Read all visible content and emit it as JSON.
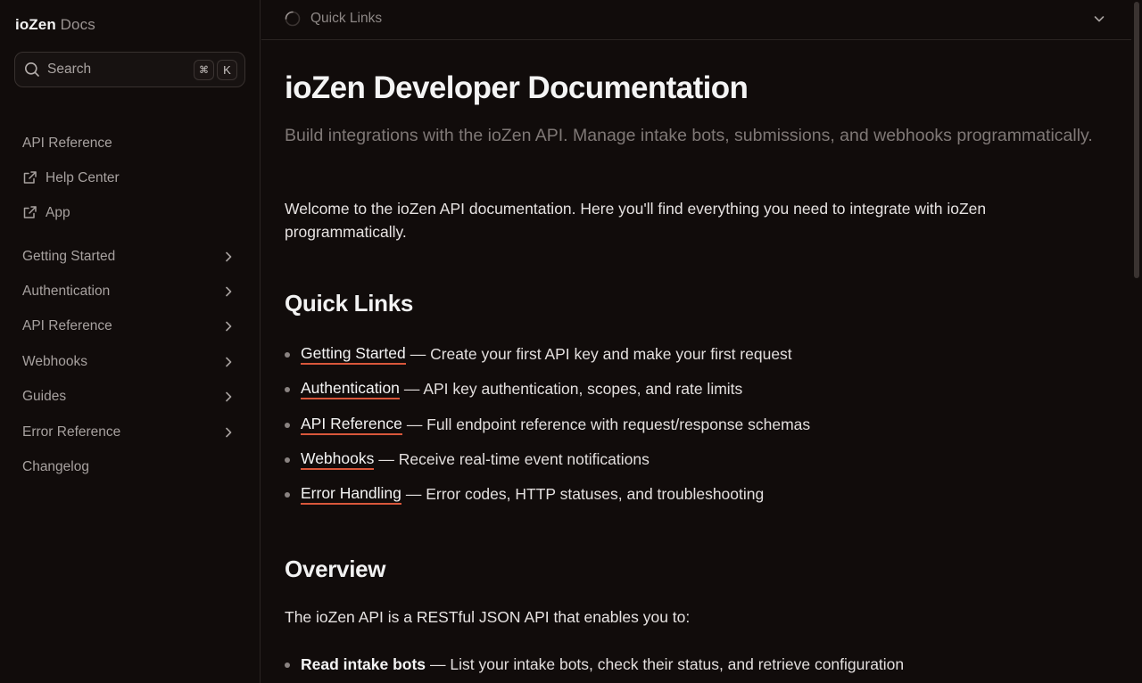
{
  "brand": {
    "name": "ioZen",
    "suffix": "Docs"
  },
  "search": {
    "label": "Search",
    "shortcut_mod": "⌘",
    "shortcut_key": "K"
  },
  "sidebar": {
    "top_links": [
      {
        "label": "API Reference",
        "icon": ""
      },
      {
        "label": "Help Center",
        "icon": "external-link-icon"
      },
      {
        "label": "App",
        "icon": "external-link-icon"
      }
    ],
    "groups": [
      {
        "label": "Getting Started",
        "expandable": true
      },
      {
        "label": "Authentication",
        "expandable": true
      },
      {
        "label": "API Reference",
        "expandable": true
      },
      {
        "label": "Webhooks",
        "expandable": true
      },
      {
        "label": "Guides",
        "expandable": true
      },
      {
        "label": "Error Reference",
        "expandable": true
      },
      {
        "label": "Changelog",
        "expandable": false
      }
    ]
  },
  "topbar": {
    "section_label": "Quick Links"
  },
  "main": {
    "title": "ioZen Developer Documentation",
    "subtitle": "Build integrations with the ioZen API. Manage intake bots, submissions, and webhooks programmatically.",
    "intro": "Welcome to the ioZen API documentation. Here you'll find everything you need to integrate with ioZen programmatically.",
    "quick_links_heading": "Quick Links",
    "quick_links": [
      {
        "link": "Getting Started",
        "desc": "— Create your first API key and make your first request"
      },
      {
        "link": "Authentication",
        "desc": "— API key authentication, scopes, and rate limits"
      },
      {
        "link": "API Reference",
        "desc": "— Full endpoint reference with request/response schemas"
      },
      {
        "link": "Webhooks",
        "desc": "— Receive real-time event notifications"
      },
      {
        "link": "Error Handling",
        "desc": "— Error codes, HTTP statuses, and troubleshooting"
      }
    ],
    "overview_heading": "Overview",
    "overview_text": "The ioZen API is a RESTful JSON API that enables you to:",
    "capabilities": [
      {
        "bold": "Read intake bots",
        "desc": "— List your intake bots, check their status, and retrieve configuration"
      }
    ]
  },
  "colors": {
    "background": "#110c0b",
    "link_underline": "#d9573b",
    "muted_text": "#a7a19f"
  }
}
